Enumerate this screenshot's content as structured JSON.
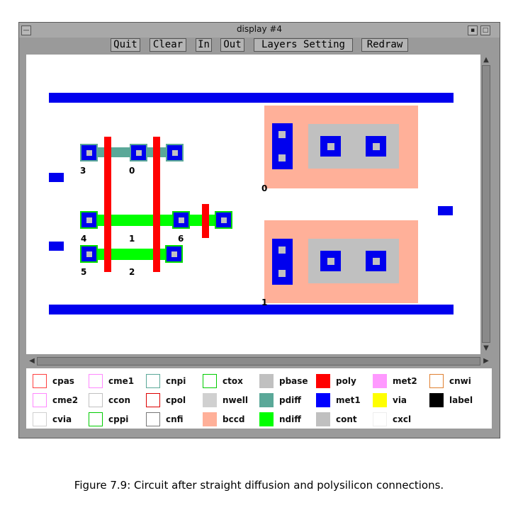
{
  "window": {
    "title": "display #4"
  },
  "title_buttons": {
    "minimize": "▪",
    "maximize": "□",
    "menu": "—"
  },
  "toolbar": {
    "quit": "Quit",
    "clear": "Clear",
    "zoom_in": "In",
    "zoom_out": "Out",
    "layers_setting": "Layers Setting",
    "redraw": "Redraw"
  },
  "node_labels": [
    "3",
    "0",
    "4",
    "1",
    "6",
    "5",
    "2",
    "0",
    "1"
  ],
  "legend": {
    "rows": [
      [
        {
          "name": "cpas",
          "color": "#ff4040",
          "style": "outline"
        },
        {
          "name": "cme1",
          "color": "#ff88ff",
          "style": "outline"
        },
        {
          "name": "cnpi",
          "color": "#5aa898",
          "style": "outline"
        },
        {
          "name": "ctox",
          "color": "#00cc00",
          "style": "outline"
        },
        {
          "name": "pbase",
          "color": "#c0c0c0",
          "style": "fill"
        },
        {
          "name": "poly",
          "color": "#ff0000",
          "style": "fill"
        },
        {
          "name": "met2",
          "color": "#ff99ff",
          "style": "fill"
        },
        {
          "name": "cnwi",
          "color": "#e08030",
          "style": "outline"
        }
      ],
      [
        {
          "name": "cme2",
          "color": "#ff88ff",
          "style": "outline"
        },
        {
          "name": "ccon",
          "color": "#c0c0c0",
          "style": "outline"
        },
        {
          "name": "cpol",
          "color": "#dd0000",
          "style": "outline"
        },
        {
          "name": "nwell",
          "color": "#d0d0d0",
          "style": "fill"
        },
        {
          "name": "pdiff",
          "color": "#5aa898",
          "style": "fill"
        },
        {
          "name": "met1",
          "color": "#0000ff",
          "style": "fill"
        },
        {
          "name": "via",
          "color": "#ffff00",
          "style": "fill"
        },
        {
          "name": "label",
          "color": "#000000",
          "style": "fill"
        }
      ],
      [
        {
          "name": "cvia",
          "color": "#d0d0d0",
          "style": "outline"
        },
        {
          "name": "cppi",
          "color": "#00cc00",
          "style": "outline"
        },
        {
          "name": "cnfi",
          "color": "#777777",
          "style": "outline"
        },
        {
          "name": "bccd",
          "color": "#ffb099",
          "style": "fill"
        },
        {
          "name": "ndiff",
          "color": "#00ff00",
          "style": "fill"
        },
        {
          "name": "cont",
          "color": "#c0c0c0",
          "style": "fill"
        },
        {
          "name": "cxcl",
          "color": "#eeeeee",
          "style": "outline"
        }
      ]
    ]
  },
  "caption": "Figure 7.9:  Circuit after straight diffusion and polysilicon connections."
}
